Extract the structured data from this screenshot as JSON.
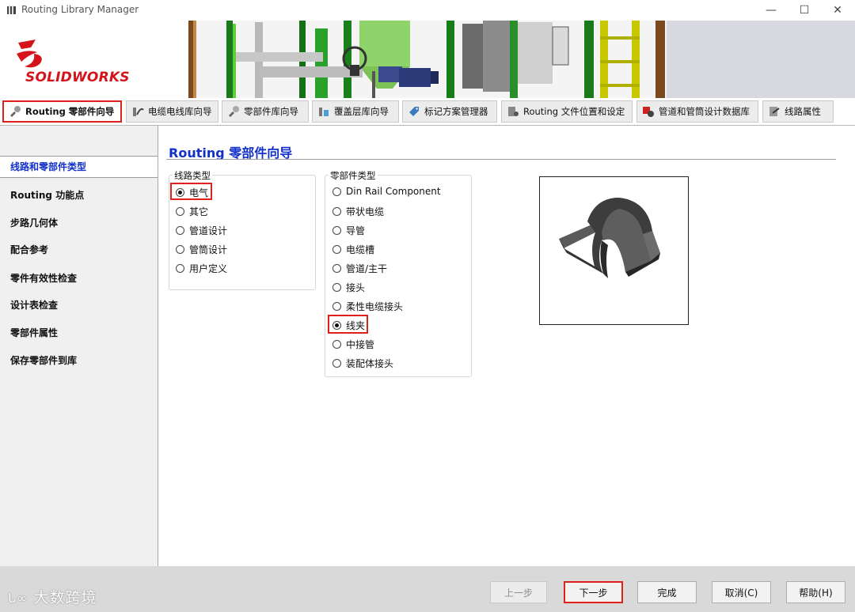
{
  "window": {
    "title": "Routing Library Manager",
    "controls": {
      "minimize": "—",
      "maximize": "☐",
      "close": "✕"
    }
  },
  "logo": {
    "brand_bold": "SOLID",
    "brand_rest": "WORKS",
    "color": "#d4141a"
  },
  "tabs": [
    {
      "label": "Routing 零部件向导",
      "icon": "pipe-fitting-icon",
      "active": true
    },
    {
      "label": "电缆电线库向导",
      "icon": "cable-library-icon",
      "active": false
    },
    {
      "label": "零部件库向导",
      "icon": "component-library-icon",
      "active": false
    },
    {
      "label": "覆盖层库向导",
      "icon": "covering-library-icon",
      "active": false
    },
    {
      "label": "标记方案管理器",
      "icon": "tag-scheme-icon",
      "active": false
    },
    {
      "label": "Routing 文件位置和设定",
      "icon": "file-settings-icon",
      "active": false
    },
    {
      "label": "管道和管筒设计数据库",
      "icon": "database-icon",
      "active": false
    },
    {
      "label": "线路属性",
      "icon": "route-properties-icon",
      "active": false
    }
  ],
  "nav": {
    "items": [
      "线路和零部件类型",
      "Routing 功能点",
      "步路几何体",
      "配合参考",
      "零件有效性检查",
      "设计表检查",
      "零部件属性",
      "保存零部件到库"
    ],
    "selected_index": 0
  },
  "main": {
    "title": "Routing 零部件向导",
    "route_type": {
      "label": "线路类型",
      "options": [
        "电气",
        "其它",
        "管道设计",
        "管筒设计",
        "用户定义"
      ],
      "selected": "电气"
    },
    "component_type": {
      "label": "零部件类型",
      "options": [
        "Din Rail Component",
        "带状电缆",
        "导管",
        "电缆槽",
        "管道/主干",
        "接头",
        "柔性电缆接头",
        "线夹",
        "中接管",
        "装配体接头"
      ],
      "selected": "线夹"
    },
    "preview": {
      "icon": "cable-clip-preview-icon"
    }
  },
  "footer": {
    "watermark": "大数跨境",
    "buttons": {
      "back": "上一步",
      "next": "下一步",
      "finish": "完成",
      "cancel": "取消(C)",
      "help": "帮助(H)"
    }
  },
  "colors": {
    "highlight": "#e0201b",
    "title_blue": "#1231c8"
  }
}
